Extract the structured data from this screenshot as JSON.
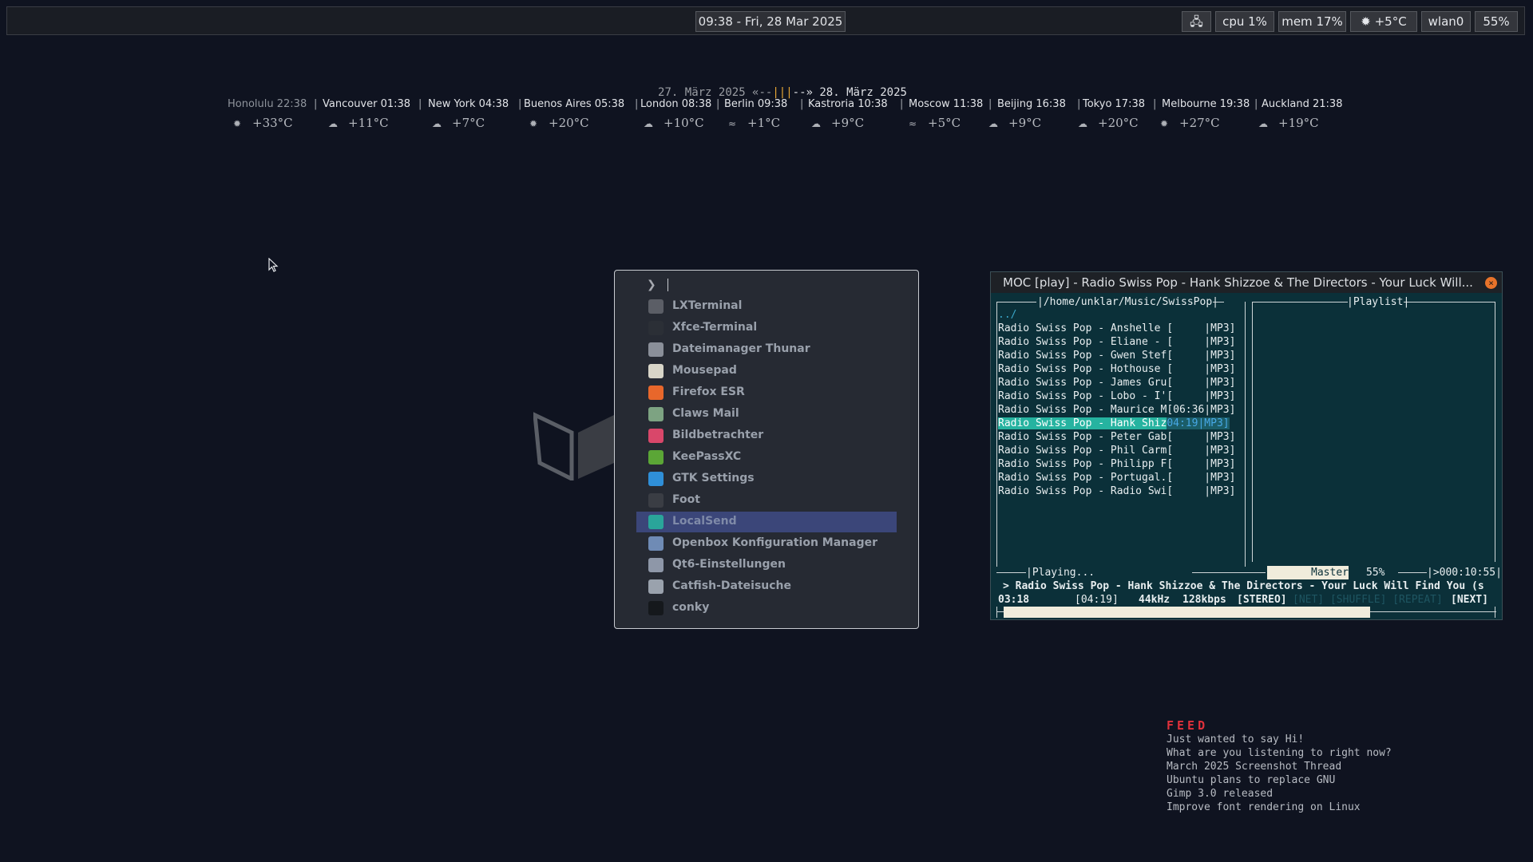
{
  "topbar": {
    "clock": "09:38 - Fri, 28 Mar 2025",
    "tray": [
      {
        "name": "network-icon-tray",
        "label": "🖧"
      },
      {
        "name": "cpu-indicator",
        "label": "cpu 1%"
      },
      {
        "name": "mem-indicator",
        "label": "mem 17%"
      },
      {
        "name": "weather-indicator",
        "label": "✹ +5°C"
      },
      {
        "name": "wlan-indicator",
        "label": "wlan0"
      },
      {
        "name": "battery-indicator",
        "label": "55%"
      }
    ]
  },
  "worldclock": {
    "date_old": "27. März 2025 «--",
    "date_bars": "|||",
    "date_new": "--» 28. März 2025",
    "cities": [
      {
        "label": "Honolulu 22:38",
        "temp": "+33°C",
        "icon": "✹"
      },
      {
        "label": "Vancouver 01:38",
        "temp": "+11°C",
        "icon": "☁"
      },
      {
        "label": "New York 04:38",
        "temp": "+7°C",
        "icon": "☁"
      },
      {
        "label": "Buenos Aires 05:38",
        "temp": "+20°C",
        "icon": "✹"
      },
      {
        "label": "London 08:38",
        "temp": "+10°C",
        "icon": "☁"
      },
      {
        "label": "Berlin 09:38",
        "temp": "+1°C",
        "icon": "≈"
      },
      {
        "label": "Kastroria 10:38",
        "temp": "+9°C",
        "icon": "☁"
      },
      {
        "label": "Moscow 11:38",
        "temp": "+5°C",
        "icon": "≈"
      },
      {
        "label": "Beijing 16:38",
        "temp": "+9°C",
        "icon": "☁"
      },
      {
        "label": "Tokyo 17:38",
        "temp": "+20°C",
        "icon": "☁"
      },
      {
        "label": "Melbourne 19:38",
        "temp": "+27°C",
        "icon": "✹"
      },
      {
        "label": "Auckland 21:38",
        "temp": "+19°C",
        "icon": "☁"
      }
    ]
  },
  "launcher": {
    "prompt": "❯",
    "items": [
      {
        "label": "LXTerminal",
        "icon": "lxterminal-icon",
        "color": "#5b5e66"
      },
      {
        "label": "Xfce-Terminal",
        "icon": "xfce-terminal-icon",
        "color": "#2b2f36"
      },
      {
        "label": "Dateimanager Thunar",
        "icon": "thunar-icon",
        "color": "#8a8f99"
      },
      {
        "label": "Mousepad",
        "icon": "mousepad-icon",
        "color": "#d8d5c8"
      },
      {
        "label": "Firefox ESR",
        "icon": "firefox-icon",
        "color": "#e8672b"
      },
      {
        "label": "Claws Mail",
        "icon": "claws-mail-icon",
        "color": "#7da382"
      },
      {
        "label": "Bildbetrachter",
        "icon": "image-viewer-icon",
        "color": "#d9476a"
      },
      {
        "label": "KeePassXC",
        "icon": "keepassxc-icon",
        "color": "#5ba636"
      },
      {
        "label": "GTK Settings",
        "icon": "gtk-settings-icon",
        "color": "#2f8fd8"
      },
      {
        "label": "Foot",
        "icon": "foot-icon",
        "color": "#3a3d44"
      },
      {
        "label": "LocalSend",
        "icon": "localsend-icon",
        "color": "#2aa59a"
      },
      {
        "label": "Openbox Konfiguration Manager",
        "icon": "openbox-config-icon",
        "color": "#6f8bb5"
      },
      {
        "label": "Qt6-Einstellungen",
        "icon": "qt-settings-icon",
        "color": "#8e97a8"
      },
      {
        "label": "Catfish-Dateisuche",
        "icon": "catfish-icon",
        "color": "#9aa2ad"
      },
      {
        "label": "conky",
        "icon": "conky-icon",
        "color": "#15181c"
      }
    ],
    "selected_index": 10
  },
  "moc": {
    "title": "MOC [play] - Radio Swiss Pop - Hank Shizzoe & The Directors - Your Luck Will...",
    "close": "×",
    "dir_header": "/home/unklar/Music/SwissPop",
    "playlist_header": "Playlist",
    "parent_dir": "../",
    "files": [
      {
        "name": "Radio Swiss Pop - Anshelle [",
        "time": "     ",
        "fmt": "|MP3]"
      },
      {
        "name": "Radio Swiss Pop - Eliane - [",
        "time": "     ",
        "fmt": "|MP3]"
      },
      {
        "name": "Radio Swiss Pop - Gwen Stef[",
        "time": "     ",
        "fmt": "|MP3]"
      },
      {
        "name": "Radio Swiss Pop - Hothouse [",
        "time": "     ",
        "fmt": "|MP3]"
      },
      {
        "name": "Radio Swiss Pop - James Gru[",
        "time": "     ",
        "fmt": "|MP3]"
      },
      {
        "name": "Radio Swiss Pop - Lobo - I'[",
        "time": "     ",
        "fmt": "|MP3]"
      },
      {
        "name": "Radio Swiss Pop - Maurice M[",
        "time": "06:36",
        "fmt": "|MP3]"
      },
      {
        "name": "Radio Swiss Pop - Hank Shiz",
        "time": "04:19",
        "fmt": "|MP3]",
        "active": true
      },
      {
        "name": "Radio Swiss Pop - Peter Gab[",
        "time": "     ",
        "fmt": "|MP3]"
      },
      {
        "name": "Radio Swiss Pop - Phil Carm[",
        "time": "     ",
        "fmt": "|MP3]"
      },
      {
        "name": "Radio Swiss Pop - Philipp F[",
        "time": "     ",
        "fmt": "|MP3]"
      },
      {
        "name": "Radio Swiss Pop - Portugal.[",
        "time": "     ",
        "fmt": "|MP3]"
      },
      {
        "name": "Radio Swiss Pop - Radio Swi[",
        "time": "     ",
        "fmt": "|MP3]"
      }
    ],
    "status": "Playing...",
    "mixer_label": "Master",
    "volume": "55%",
    "total_time": ">000:10:55",
    "now_playing": "> Radio Swiss Pop - Hank Shizzoe & The Directors - Your Luck Will Find You (s",
    "elapsed": "03:18",
    "remaining": "[04:19]",
    "khz": "44kHz",
    "kbps": "128kbps",
    "stereo": "[STEREO]",
    "flags": "[NET] [SHUFFLE] [REPEAT]",
    "next": "[NEXT]",
    "progress_fraction": 0.76
  },
  "feed": {
    "title": "FEED",
    "items": [
      "Just wanted to say Hi!",
      "What are you listening to right now?",
      "March 2025 Screenshot Thread",
      "Ubuntu plans to replace GNU",
      "Gimp 3.0 released",
      "Improve font rendering on Linux"
    ]
  }
}
